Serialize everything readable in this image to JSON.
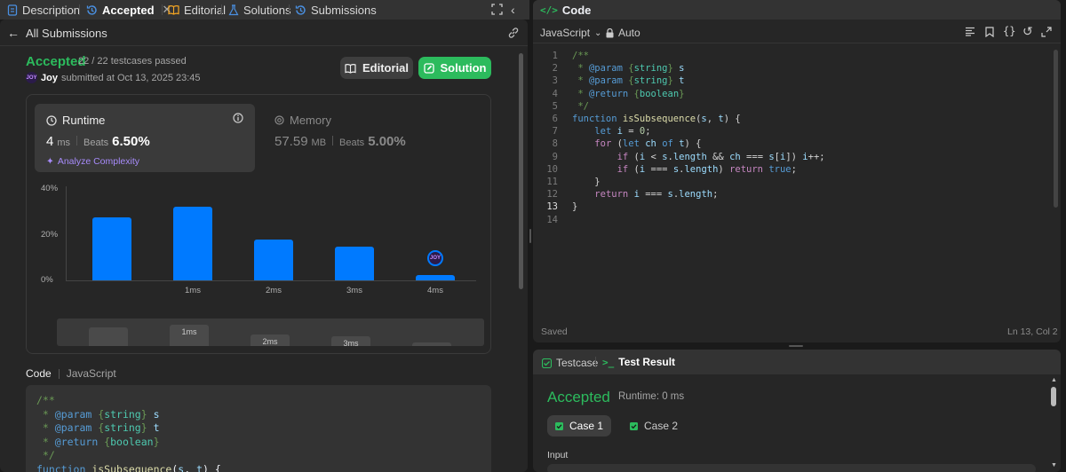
{
  "tabs": [
    {
      "label": "Description",
      "icon": "document-icon"
    },
    {
      "label": "Accepted",
      "icon": "history-icon"
    },
    {
      "label": "Editorial",
      "icon": "book-icon"
    },
    {
      "label": "Solutions",
      "icon": "flask-icon"
    },
    {
      "label": "Submissions",
      "icon": "history-icon"
    }
  ],
  "submission": {
    "back_label": "All Submissions",
    "status": "Accepted",
    "testcases": "22 / 22 testcases passed",
    "user": "Joy",
    "submitted_at": "submitted at Oct 13, 2025 23:45",
    "avatar_text": "JOY",
    "editorial_btn": "Editorial",
    "solution_btn": "Solution"
  },
  "runtime": {
    "label": "Runtime",
    "value": "4",
    "unit": "ms",
    "beats_label": "Beats",
    "beats": "6.50%",
    "analyze": "Analyze Complexity"
  },
  "memory": {
    "label": "Memory",
    "value": "57.59",
    "unit": "MB",
    "beats_label": "Beats",
    "beats": "5.00%"
  },
  "chart_data": {
    "type": "bar",
    "y_ticks": [
      "40%",
      "20%",
      "0%"
    ],
    "ylim": [
      0,
      40
    ],
    "categories": [
      "",
      "1ms",
      "2ms",
      "3ms",
      "4ms"
    ],
    "values": [
      27.5,
      32.2,
      17.8,
      14.6,
      2.4
    ],
    "highlight": "4ms",
    "mini_labels": [
      "",
      "1ms",
      "2ms",
      "3ms",
      "4ms"
    ]
  },
  "code_section": {
    "code_label": "Code",
    "lang_label": "JavaScript",
    "lines": [
      "/**",
      " * @param {string} s",
      " * @param {string} t",
      " * @return {boolean}",
      " */",
      "function isSubsequence(s, t) {"
    ]
  },
  "editor": {
    "title": "Code",
    "language": "JavaScript",
    "mode": "Auto",
    "saved": "Saved",
    "position": "Ln 13, Col 2",
    "line_numbers": [
      "1",
      "2",
      "3",
      "4",
      "5",
      "6",
      "7",
      "8",
      "9",
      "10",
      "11",
      "12",
      "13",
      "14"
    ]
  },
  "bottom": {
    "testcase_tab": "Testcase",
    "result_tab": "Test Result",
    "status": "Accepted",
    "runtime": "Runtime: 0 ms",
    "cases": [
      "Case 1",
      "Case 2"
    ],
    "input_label": "Input"
  },
  "colors": {
    "accent_green": "#2cbb5d",
    "bar_blue": "#007aff",
    "panel": "#262626"
  }
}
